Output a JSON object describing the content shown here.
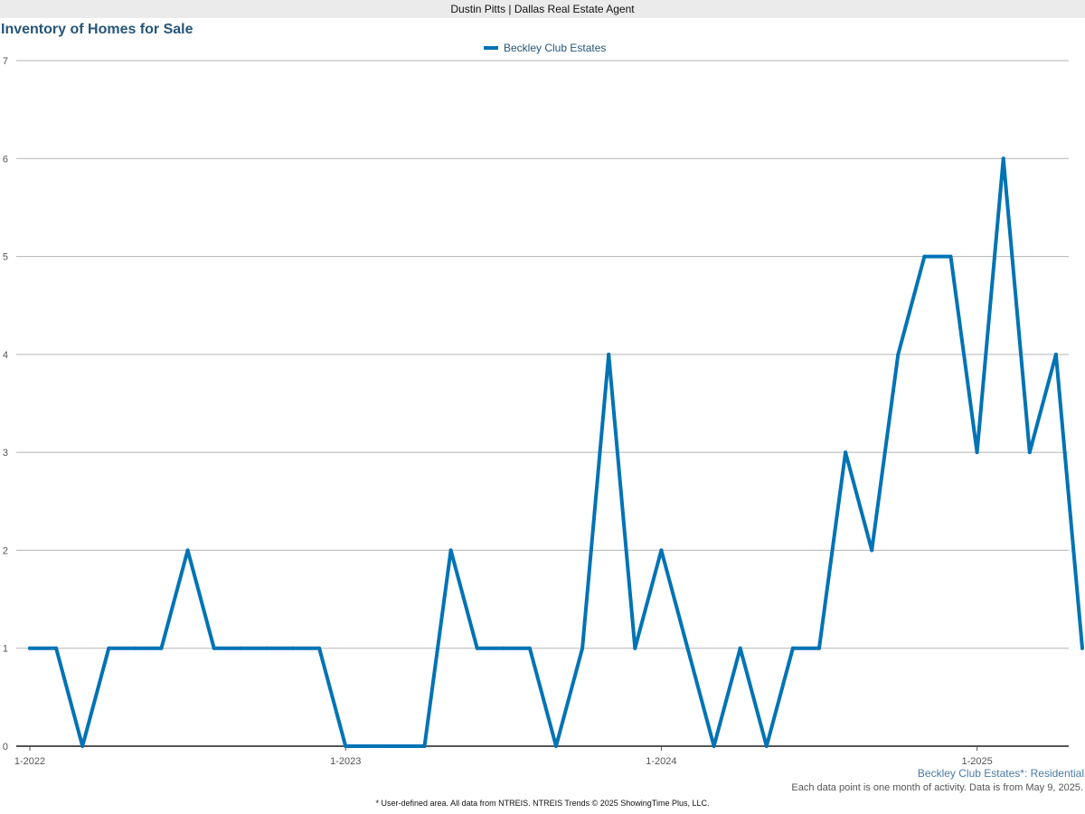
{
  "header": {
    "text": "Dustin Pitts | Dallas Real Estate Agent"
  },
  "footer": {
    "subtitle": "Beckley Club Estates*: Residential",
    "note": "Each data point is one month of activity. Data is from May 9, 2025.",
    "source": "* User-defined area. All data from NTREIS. NTREIS Trends © 2025 ShowingTime Plus, LLC."
  },
  "chart_data": {
    "type": "line",
    "title": "Inventory of Homes for Sale",
    "xlabel": "",
    "ylabel": "",
    "ylim": [
      0,
      7
    ],
    "yticks": [
      0,
      1,
      2,
      3,
      4,
      5,
      6,
      7
    ],
    "x_tick_labels": [
      "1-2022",
      "1-2023",
      "1-2024",
      "1-2025"
    ],
    "x_start": "2022-01",
    "grid": true,
    "legend_position": "top-center",
    "colors": {
      "series": "#0073b5",
      "grid": "#b5b5b5",
      "axis": "#555555"
    },
    "series": [
      {
        "name": "Beckley Club Estates",
        "values": [
          1,
          1,
          0,
          1,
          1,
          1,
          2,
          1,
          1,
          1,
          1,
          1,
          0,
          0,
          0,
          0,
          2,
          1,
          1,
          1,
          0,
          1,
          4,
          1,
          2,
          1,
          0,
          1,
          0,
          1,
          1,
          3,
          2,
          4,
          5,
          5,
          3,
          6,
          3,
          4,
          1
        ]
      }
    ]
  }
}
